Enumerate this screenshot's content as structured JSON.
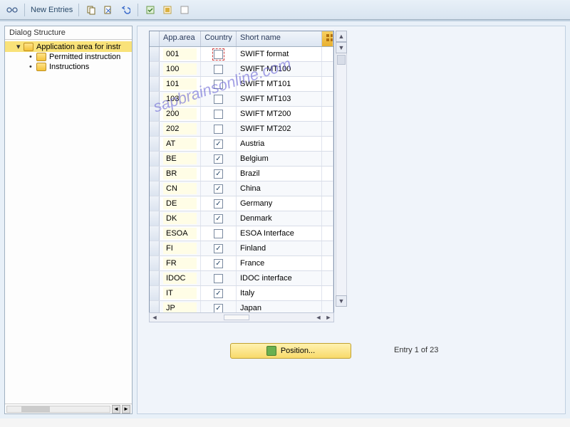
{
  "toolbar": {
    "new_entries": "New Entries"
  },
  "left_panel": {
    "title": "Dialog Structure",
    "tree": {
      "root": "Application area for instr",
      "child1": "Permitted instruction",
      "child2": "Instructions"
    }
  },
  "table": {
    "headers": {
      "area": "App.area",
      "country": "Country",
      "short": "Short name"
    },
    "rows": [
      {
        "area": "001",
        "country": false,
        "name": "SWIFT format",
        "focus": true
      },
      {
        "area": "100",
        "country": false,
        "name": "SWIFT MT100"
      },
      {
        "area": "101",
        "country": false,
        "name": "SWIFT MT101"
      },
      {
        "area": "103",
        "country": false,
        "name": "SWIFT MT103"
      },
      {
        "area": "200",
        "country": false,
        "name": "SWIFT MT200"
      },
      {
        "area": "202",
        "country": false,
        "name": "SWIFT MT202"
      },
      {
        "area": "AT",
        "country": true,
        "name": "Austria"
      },
      {
        "area": "BE",
        "country": true,
        "name": "Belgium"
      },
      {
        "area": "BR",
        "country": true,
        "name": "Brazil"
      },
      {
        "area": "CN",
        "country": true,
        "name": "China"
      },
      {
        "area": "DE",
        "country": true,
        "name": "Germany"
      },
      {
        "area": "DK",
        "country": true,
        "name": "Denmark"
      },
      {
        "area": "ESOA",
        "country": false,
        "name": "ESOA Interface"
      },
      {
        "area": "FI",
        "country": true,
        "name": "Finland"
      },
      {
        "area": "FR",
        "country": true,
        "name": "France"
      },
      {
        "area": "IDOC",
        "country": false,
        "name": "IDOC interface"
      },
      {
        "area": "IT",
        "country": true,
        "name": "Italy"
      },
      {
        "area": "JP",
        "country": true,
        "name": "Japan"
      }
    ]
  },
  "footer": {
    "position_label": "Position...",
    "entry_text": "Entry 1 of 23"
  },
  "watermark": "sapbrainsonline.com"
}
